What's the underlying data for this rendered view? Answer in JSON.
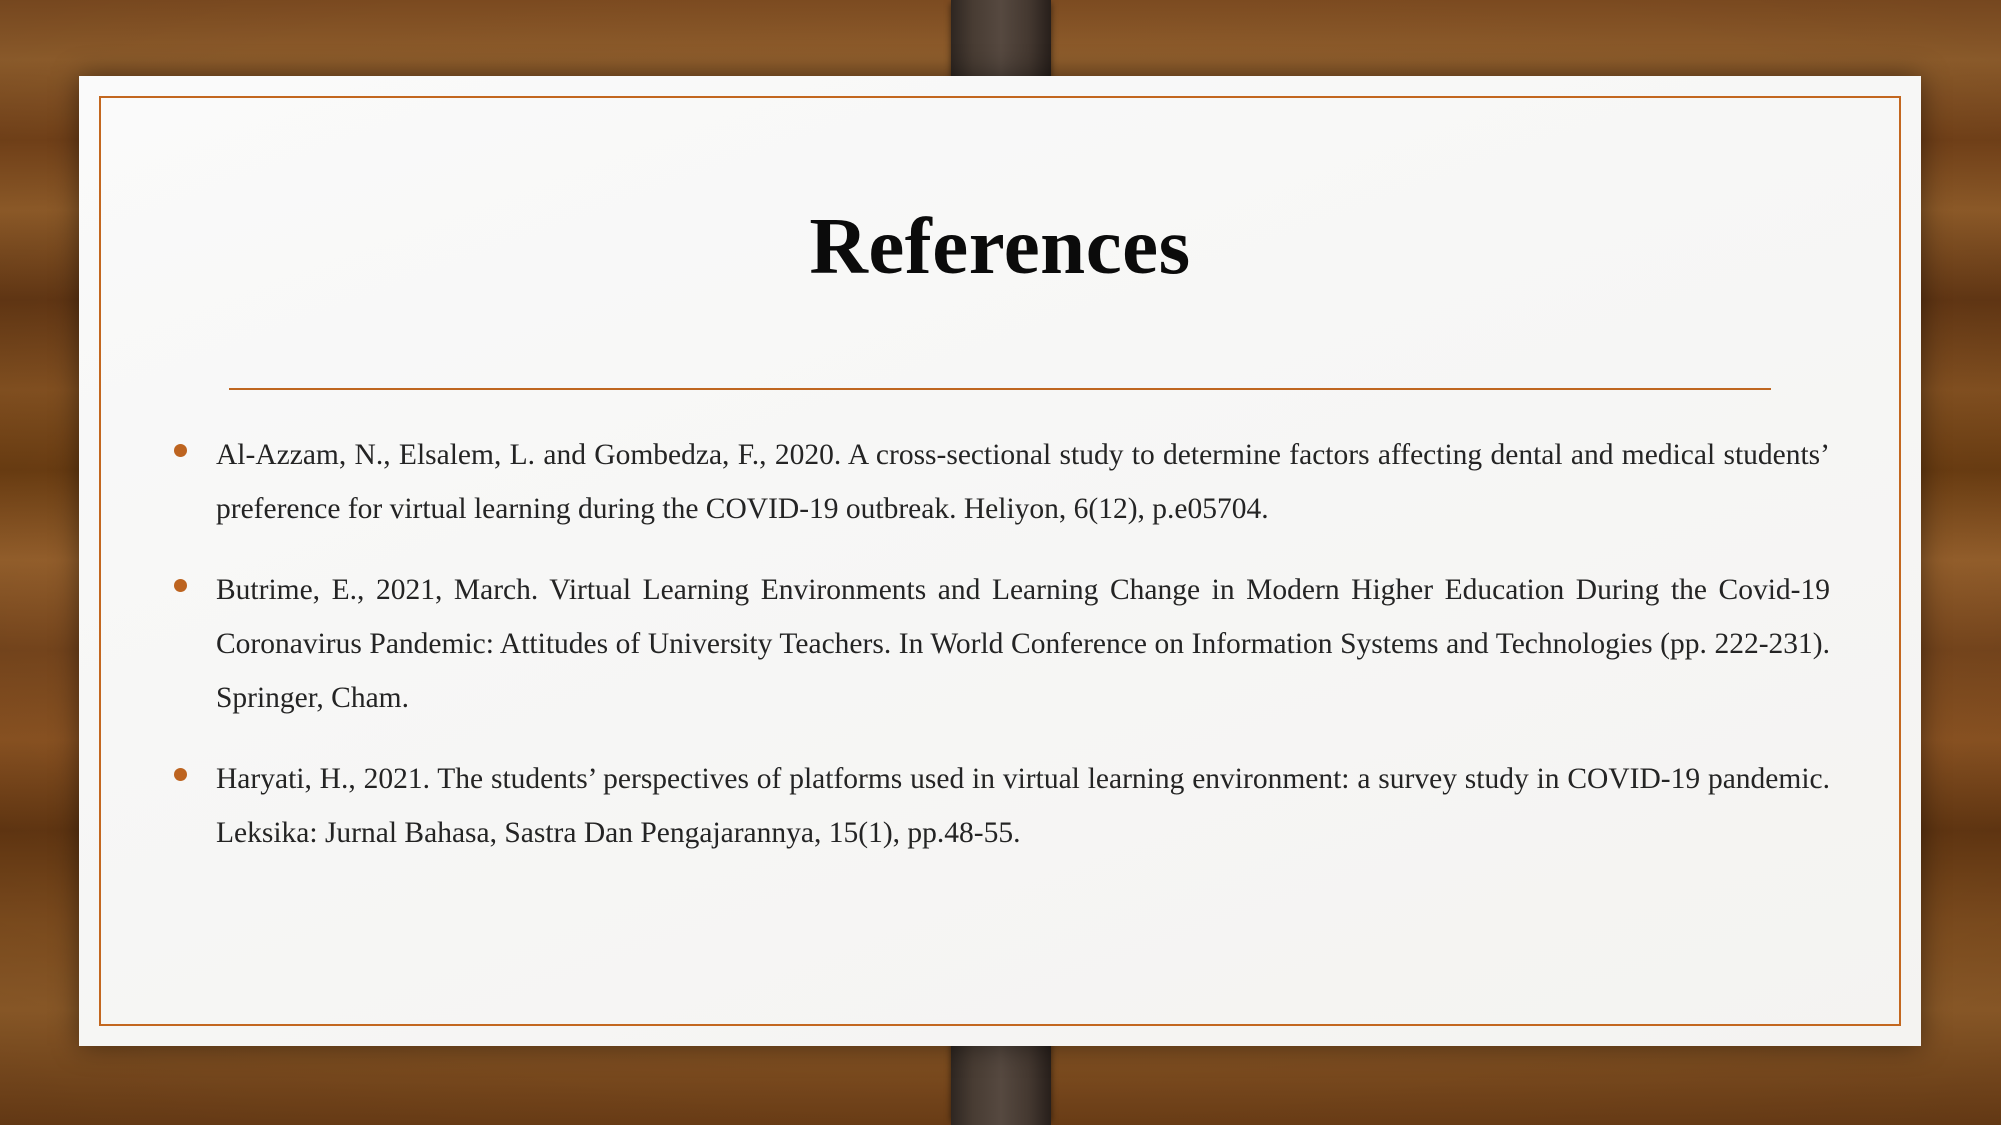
{
  "slide": {
    "title": "References",
    "accent_color": "#bf6620",
    "paper_color": "#f8f8f7",
    "text_color": "#242424",
    "background": "wood-desk",
    "references": [
      {
        "bullet": "bullet-dot",
        "text": "Al-Azzam, N., Elsalem, L. and Gombedza, F., 2020. A cross-sectional study to determine factors affecting dental and medical students’ preference for virtual learning during the COVID-19 outbreak. Heliyon, 6(12), p.e05704."
      },
      {
        "bullet": "bullet-dot",
        "text": "Butrime, E., 2021, March. Virtual Learning Environments and Learning Change in Modern Higher Education During the Covid-19 Coronavirus Pandemic: Attitudes of University Teachers. In World Conference on Information Systems and Technologies (pp. 222-231). Springer, Cham."
      },
      {
        "bullet": "bullet-dot",
        "text": "Haryati, H., 2021. The students’ perspectives of platforms used in virtual learning environment: a survey study in COVID-19 pandemic. Leksika: Jurnal Bahasa, Sastra Dan Pengajarannya, 15(1), pp.48-55."
      }
    ]
  }
}
